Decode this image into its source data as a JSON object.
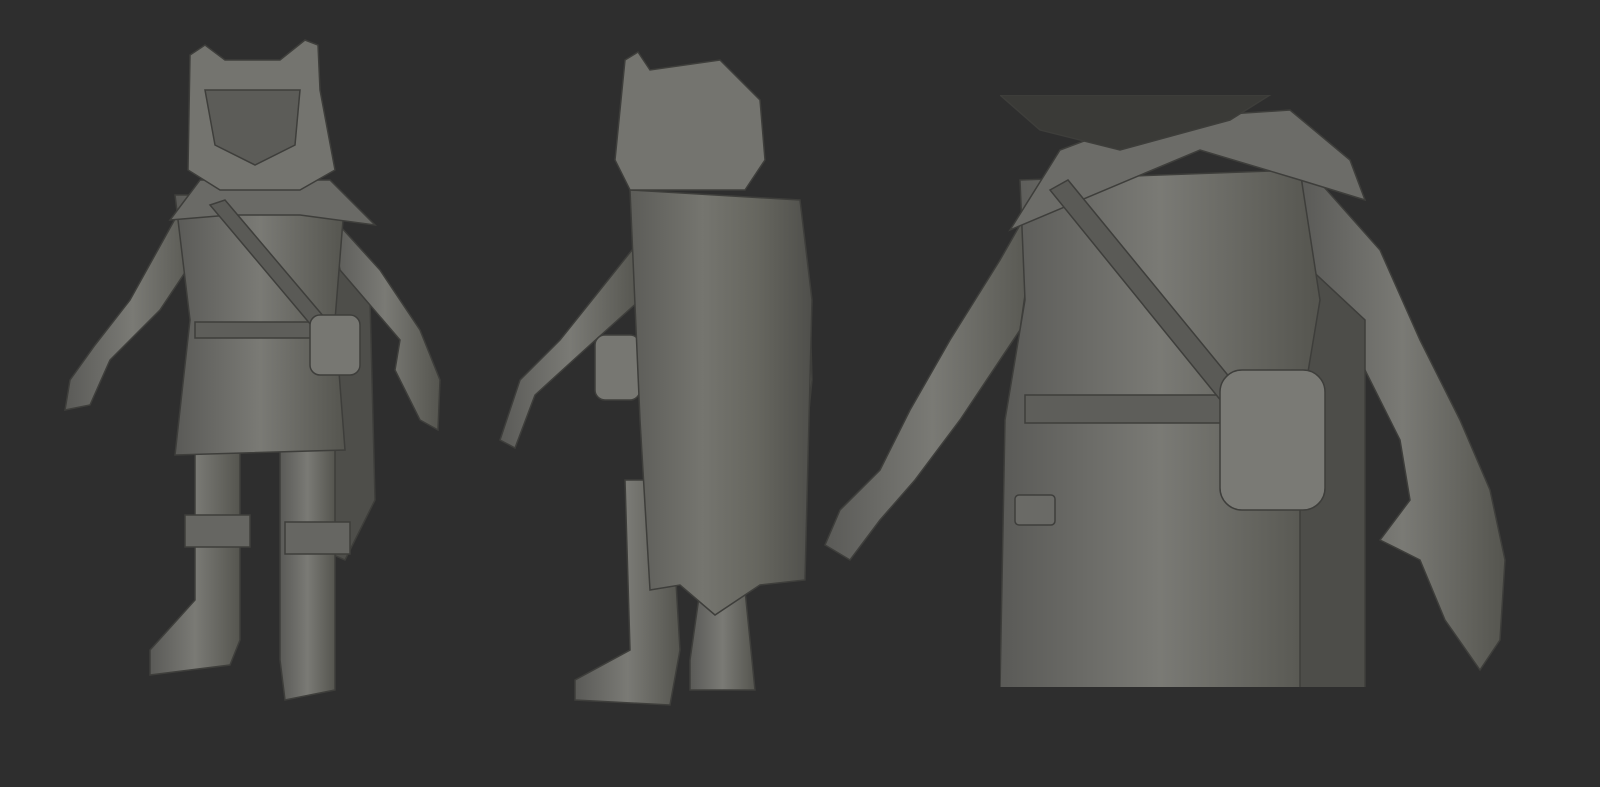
{
  "scene": {
    "background": "#2e2e2e",
    "sculpt_color": "#6f6f6b",
    "sculpt_shadow": "#4a4a47",
    "sculpt_highlight": "#9a9a95"
  }
}
